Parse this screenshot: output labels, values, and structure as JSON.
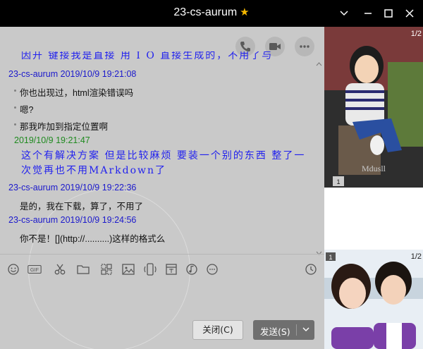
{
  "window": {
    "title": "23-cs-aurum",
    "star_icon": "star-icon",
    "controls": [
      "chevron-down-icon",
      "minimize-icon",
      "maximize-icon",
      "close-icon"
    ]
  },
  "chat_actions": [
    "phone-icon",
    "video-icon",
    "more-icon"
  ],
  "messages": {
    "partial_top": "因开 键接我是直接 用 Ι O 直接生成的，不用了与",
    "m1_header": "23-cs-aurum 2019/10/9 19:21:08",
    "m1_lines": [
      "你也出现过，html渲染错误吗",
      "嗯?",
      "那我咋加到指定位置啊"
    ],
    "m2_header": "2019/10/9 19:21:47",
    "m2_text": "这个有解决方案 但是比较麻烦 要装一个别的东西 整了一次觉再也不用MArkdown了",
    "m3_header": "23-cs-aurum 2019/10/9 19:22:36",
    "m3_text": "是的，我在下载，算了，不用了",
    "m4_header": "23-cs-aurum 2019/10/9 19:24:56",
    "m4_text": "你不是！[](http://..........)这样的格式么"
  },
  "input_tools": [
    "emoji-icon",
    "gif-icon",
    "scissors-icon",
    "folder-icon",
    "image-grid-icon",
    "image-icon",
    "shake-icon",
    "calendar-icon",
    "music-icon",
    "more-circle-icon",
    "clock-icon"
  ],
  "gif_label": "GIF",
  "buttons": {
    "close_label": "关闭(C)",
    "send_label": "发送(S)"
  },
  "show_panel": {
    "top_pager": "1/2",
    "top_caption": "Mdusll",
    "top_badge": "1",
    "bottom_pager": "1/2",
    "bottom_badge": "1"
  },
  "colors": {
    "title_bar": "#000000",
    "chat_bg": "#c9c9c9",
    "peer_header": "#1b19cc",
    "self_header": "#1f8a1f",
    "self_text": "#2222ee",
    "send_button": "#6f6f6f"
  }
}
